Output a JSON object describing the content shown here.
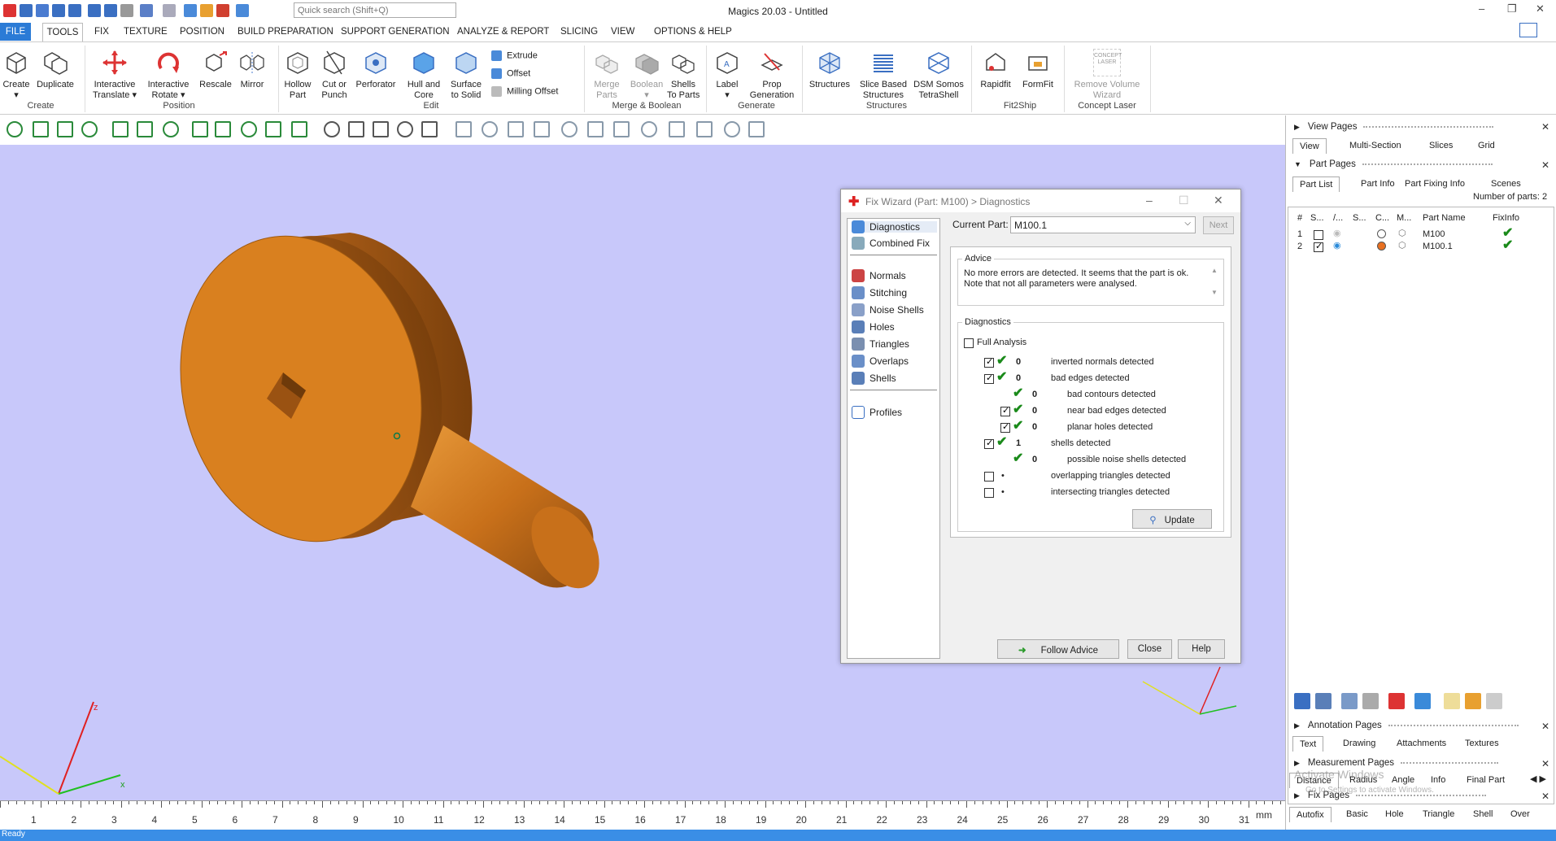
{
  "titlebar": {
    "search_placeholder": "Quick search (Shift+Q)",
    "app_title": "Magics 20.03 - Untitled",
    "minimize": "–",
    "restore": "❐",
    "close": "✕"
  },
  "menu": {
    "items": [
      "FILE",
      "TOOLS",
      "FIX",
      "TEXTURE",
      "POSITION",
      "BUILD PREPARATION",
      "SUPPORT GENERATION",
      "ANALYZE & REPORT",
      "SLICING",
      "VIEW",
      "OPTIONS & HELP"
    ]
  },
  "ribbon": {
    "create": {
      "create": "Create",
      "duplicate": "Duplicate",
      "group": "Create"
    },
    "position": {
      "interactive_translate": "Interactive\nTranslate ▾",
      "interactive_rotate": "Interactive\nRotate ▾",
      "rescale": "Rescale",
      "mirror": "Mirror",
      "group": "Position"
    },
    "edit": {
      "hollow_part": "Hollow\nPart",
      "cut_punch": "Cut or\nPunch",
      "perforator": "Perforator",
      "hull_core": "Hull and\nCore",
      "surface_solid": "Surface\nto Solid",
      "extrude": "Extrude",
      "offset": "Offset",
      "milling_offset": "Milling Offset",
      "group": "Edit"
    },
    "merge": {
      "merge_parts": "Merge\nParts",
      "boolean": "Boolean",
      "shells_to_parts": "Shells\nTo Parts",
      "group": "Merge & Boolean"
    },
    "generate": {
      "label": "Label",
      "prop_generation": "Prop\nGeneration",
      "group": "Generate"
    },
    "structures": {
      "structures": "Structures",
      "slice_based": "Slice Based\nStructures",
      "dsm": "DSM Somos\nTetraShell",
      "group": "Structures"
    },
    "fit2ship": {
      "rapidfit": "Rapidfit",
      "formfit": "FormFit",
      "group": "Fit2Ship"
    },
    "concept": {
      "remove_volume": "Remove Volume\nWizard",
      "group": "Concept Laser",
      "icon_text": "CONCEPT\nLASER"
    }
  },
  "dialog": {
    "title": "Fix Wizard (Part: M100) > Diagnostics",
    "nav": [
      "Diagnostics",
      "Combined Fix",
      "Normals",
      "Stitching",
      "Noise Shells",
      "Holes",
      "Triangles",
      "Overlaps",
      "Shells",
      "Profiles"
    ],
    "current_part_label": "Current Part:",
    "current_part_value": "M100.1",
    "next_label": "Next",
    "advice_title": "Advice",
    "advice_text": "No more errors are detected. It seems that the part is ok. Note that not all parameters were analysed.",
    "diagnostics_title": "Diagnostics",
    "full_analysis": "Full Analysis",
    "rows": [
      {
        "count": "0",
        "text": "inverted normals detected"
      },
      {
        "count": "0",
        "text": "bad edges detected"
      },
      {
        "count": "0",
        "text": "bad contours detected"
      },
      {
        "count": "0",
        "text": "near bad edges detected"
      },
      {
        "count": "0",
        "text": "planar holes detected"
      },
      {
        "count": "1",
        "text": "shells detected"
      },
      {
        "count": "0",
        "text": "possible noise shells detected"
      },
      {
        "count": "•",
        "text": "overlapping triangles detected"
      },
      {
        "count": "•",
        "text": "intersecting triangles detected"
      }
    ],
    "update_label": "Update",
    "follow_advice": "Follow Advice",
    "close": "Close",
    "help": "Help"
  },
  "right_panel": {
    "view_pages": "View Pages",
    "view_tabs": [
      "View",
      "Multi-Section",
      "Slices",
      "Grid"
    ],
    "part_pages": "Part Pages",
    "part_tabs": [
      "Part List",
      "Part Info",
      "Part Fixing Info",
      "Scenes"
    ],
    "number_of_parts": "Number of parts: 2",
    "columns": [
      "#",
      "S...",
      "/...",
      "S...",
      "C...",
      "M...",
      "Part Name",
      "FixInfo"
    ],
    "parts": [
      {
        "index": "1",
        "name": "M100"
      },
      {
        "index": "2",
        "name": "M100.1"
      }
    ],
    "annotation_pages": "Annotation Pages",
    "annotation_tabs": [
      "Text",
      "Drawing",
      "Attachments",
      "Textures"
    ],
    "measurement_pages": "Measurement Pages",
    "measurement_tabs": [
      "Distance",
      "Radius",
      "Angle",
      "Info",
      "Final Part"
    ],
    "fix_pages": "Fix Pages",
    "fix_tabs": [
      "Autofix",
      "Basic",
      "Hole",
      "Triangle",
      "Shell",
      "Over"
    ],
    "watermark1": "Activate Windows",
    "watermark2": "Go to Settings to activate Windows."
  },
  "ruler": {
    "ticks": [
      "1",
      "2",
      "3",
      "4",
      "5",
      "6",
      "7",
      "8",
      "9",
      "10",
      "11",
      "12",
      "13",
      "14",
      "15",
      "16",
      "17",
      "18",
      "19",
      "20",
      "21",
      "22",
      "23",
      "24",
      "25",
      "26",
      "27",
      "28",
      "29",
      "30",
      "31"
    ],
    "unit": "mm"
  },
  "axes": {
    "z": "z",
    "x": "x"
  },
  "status": {
    "text": "Ready"
  },
  "colors": {
    "accent": "#2b7bd6",
    "viewport": "#c8c8fa",
    "part": "#d9801f",
    "check": "#1a8a1a"
  }
}
